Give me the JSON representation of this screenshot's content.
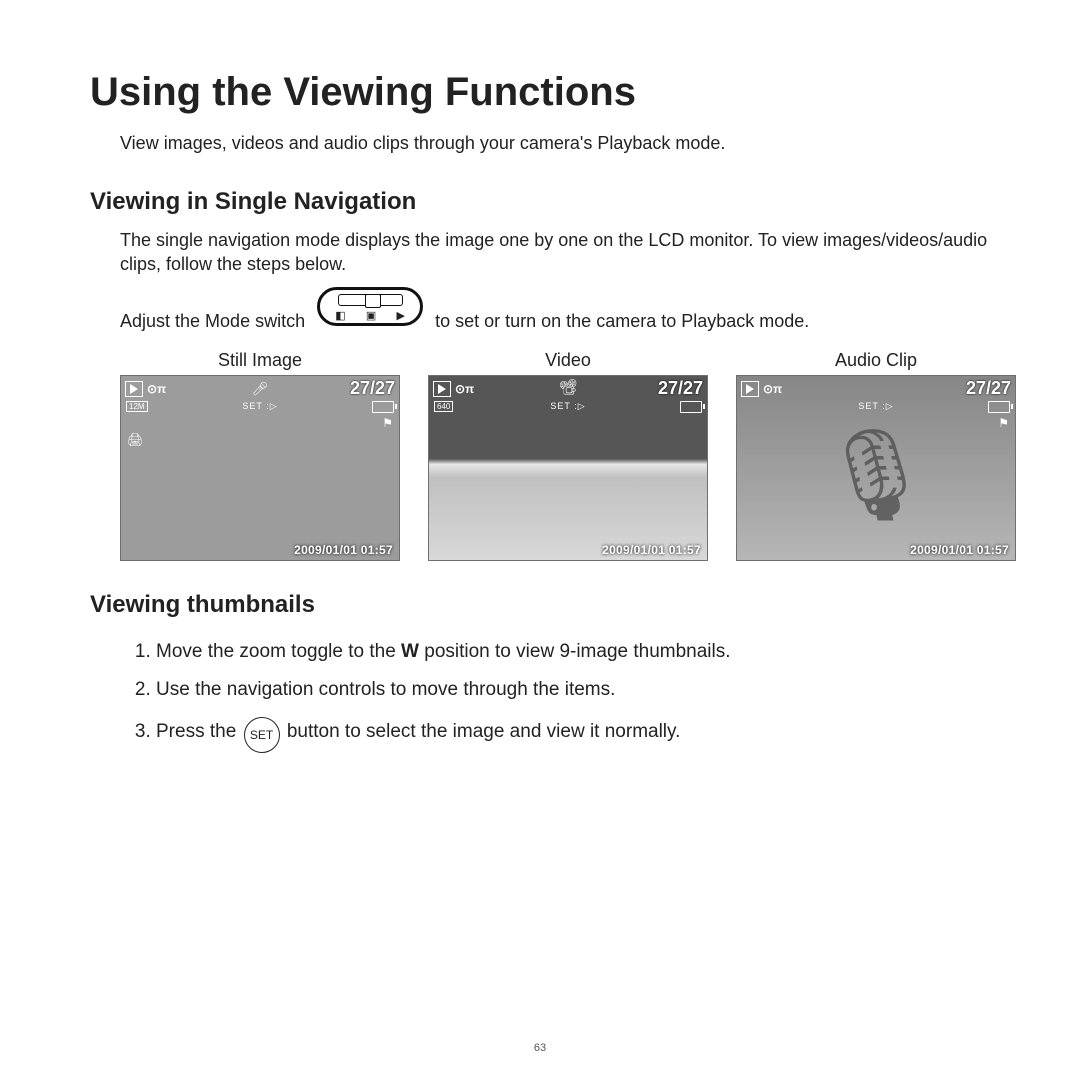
{
  "title": "Using the Viewing Functions",
  "intro": "View images, videos and audio clips through your camera's Playback mode.",
  "section1": {
    "heading": "Viewing in Single Navigation",
    "para": "The single navigation mode displays the image one by one on the LCD monitor. To view images/videos/audio clips, follow the steps below.",
    "mode_pre": "Adjust the Mode switch",
    "mode_post": "to set or turn on the camera to Playback mode."
  },
  "screens": {
    "still": {
      "label": "Still Image",
      "counter": "27/27",
      "res": "12M",
      "set": "SET :▷",
      "date": "2009/01/01  01:57"
    },
    "video": {
      "label": "Video",
      "counter": "27/27",
      "res": "640",
      "set": "SET :▷",
      "date": "2009/01/01  01:57"
    },
    "audio": {
      "label": "Audio Clip",
      "counter": "27/27",
      "set": "SET :▷",
      "date": "2009/01/01  01:57"
    }
  },
  "section2": {
    "heading": "Viewing thumbnails",
    "step1a": "Move the zoom toggle to the ",
    "step1b": "W",
    "step1c": " position to view 9-image thumbnails.",
    "step2": "Use the navigation controls to move through the items.",
    "step3a": "Press the ",
    "step3b": " button to select the image and view it normally.",
    "set_label": "SET"
  },
  "page_number": "63"
}
